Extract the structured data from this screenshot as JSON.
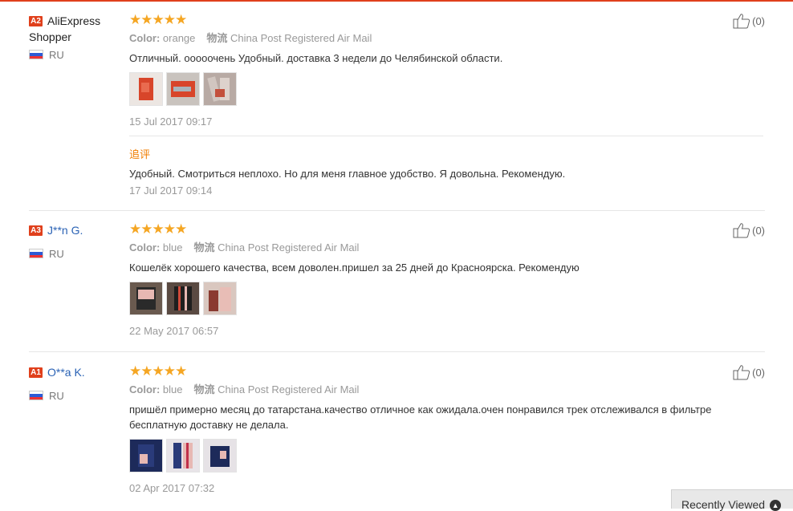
{
  "reviews": [
    {
      "level": "A2",
      "user": "AliExpress Shopper",
      "country": "RU",
      "color_label": "Color:",
      "color_value": "orange",
      "shipping_label": "物流",
      "shipping_value": "China Post Registered Air Mail",
      "text": "Отличный. ооооочень Удобный. доставка 3 недели до Челябинской области.",
      "date": "15 Jul 2017 09:17",
      "likes": "(0)",
      "followup": {
        "label": "追评",
        "text": "Удобный. Смотриться неплохо. Но для меня главное удобство. Я довольна. Рекомендую.",
        "date": "17 Jul 2017 09:14"
      }
    },
    {
      "level": "A3",
      "user": "J**n G.",
      "country": "RU",
      "color_label": "Color:",
      "color_value": "blue",
      "shipping_label": "物流",
      "shipping_value": "China Post Registered Air Mail",
      "text": "Кошелёк хорошего качества, всем доволен.пришел за 25 дней до Красноярска. Рекомендую",
      "date": "22 May 2017 06:57",
      "likes": "(0)"
    },
    {
      "level": "A1",
      "user": "O**a K.",
      "country": "RU",
      "color_label": "Color:",
      "color_value": "blue",
      "shipping_label": "物流",
      "shipping_value": "China Post Registered Air Mail",
      "text_line1": "пришёл примерно месяц до татарстана.качество отличное как ожидала.очен понравился трек отслеживался в фильтре",
      "text_line2": "бесплатную доставку не делала.",
      "date": "02 Apr 2017 07:32",
      "likes": "(0)"
    }
  ],
  "recently_viewed": "Recently Viewed",
  "colors": {
    "accent": "#e0401c",
    "star": "#f5a623",
    "link": "#2b63b5",
    "followup": "#f07d00"
  },
  "icons": {
    "like": "thumbs-up-icon",
    "flag": "russia-flag-icon",
    "expand": "chevron-up-icon"
  }
}
